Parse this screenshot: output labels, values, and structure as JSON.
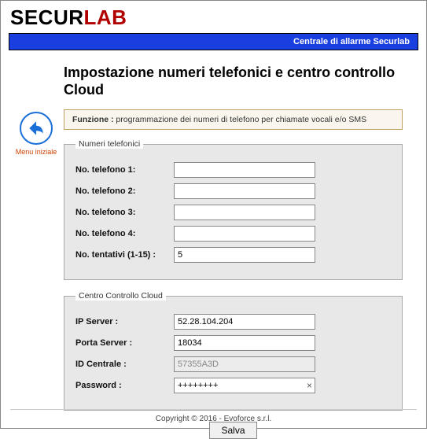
{
  "logo": {
    "part1": "SECUR",
    "part2": "LAB"
  },
  "bluebar": "Centrale di allarme Securlab",
  "sidebar": {
    "back_label": "Menu iniziale"
  },
  "title": "Impostazione numeri telefonici e centro controllo Cloud",
  "funcbox": {
    "label": "Funzione :",
    "text": " programmazione dei numeri di telefono per chiamate vocali e/o SMS"
  },
  "fs_phones": {
    "legend": "Numeri telefonici",
    "fields": {
      "tel1": {
        "label": "No. telefono 1:",
        "value": ""
      },
      "tel2": {
        "label": "No. telefono 2:",
        "value": ""
      },
      "tel3": {
        "label": "No. telefono 3:",
        "value": ""
      },
      "tel4": {
        "label": "No. telefono 4:",
        "value": ""
      },
      "attempts": {
        "label": "No. tentativi (1-15) :",
        "value": "5"
      }
    }
  },
  "fs_cloud": {
    "legend": "Centro Controllo Cloud",
    "fields": {
      "ip": {
        "label": "IP Server :",
        "value": "52.28.104.204"
      },
      "port": {
        "label": "Porta Server :",
        "value": "18034"
      },
      "id": {
        "label": "ID Centrale :",
        "value": "57355A3D"
      },
      "pwd": {
        "label": "Password :",
        "value": "++++++++"
      }
    }
  },
  "save_label": "Salva",
  "footer": "Copyright © 2016 - Evoforce s.r.l."
}
